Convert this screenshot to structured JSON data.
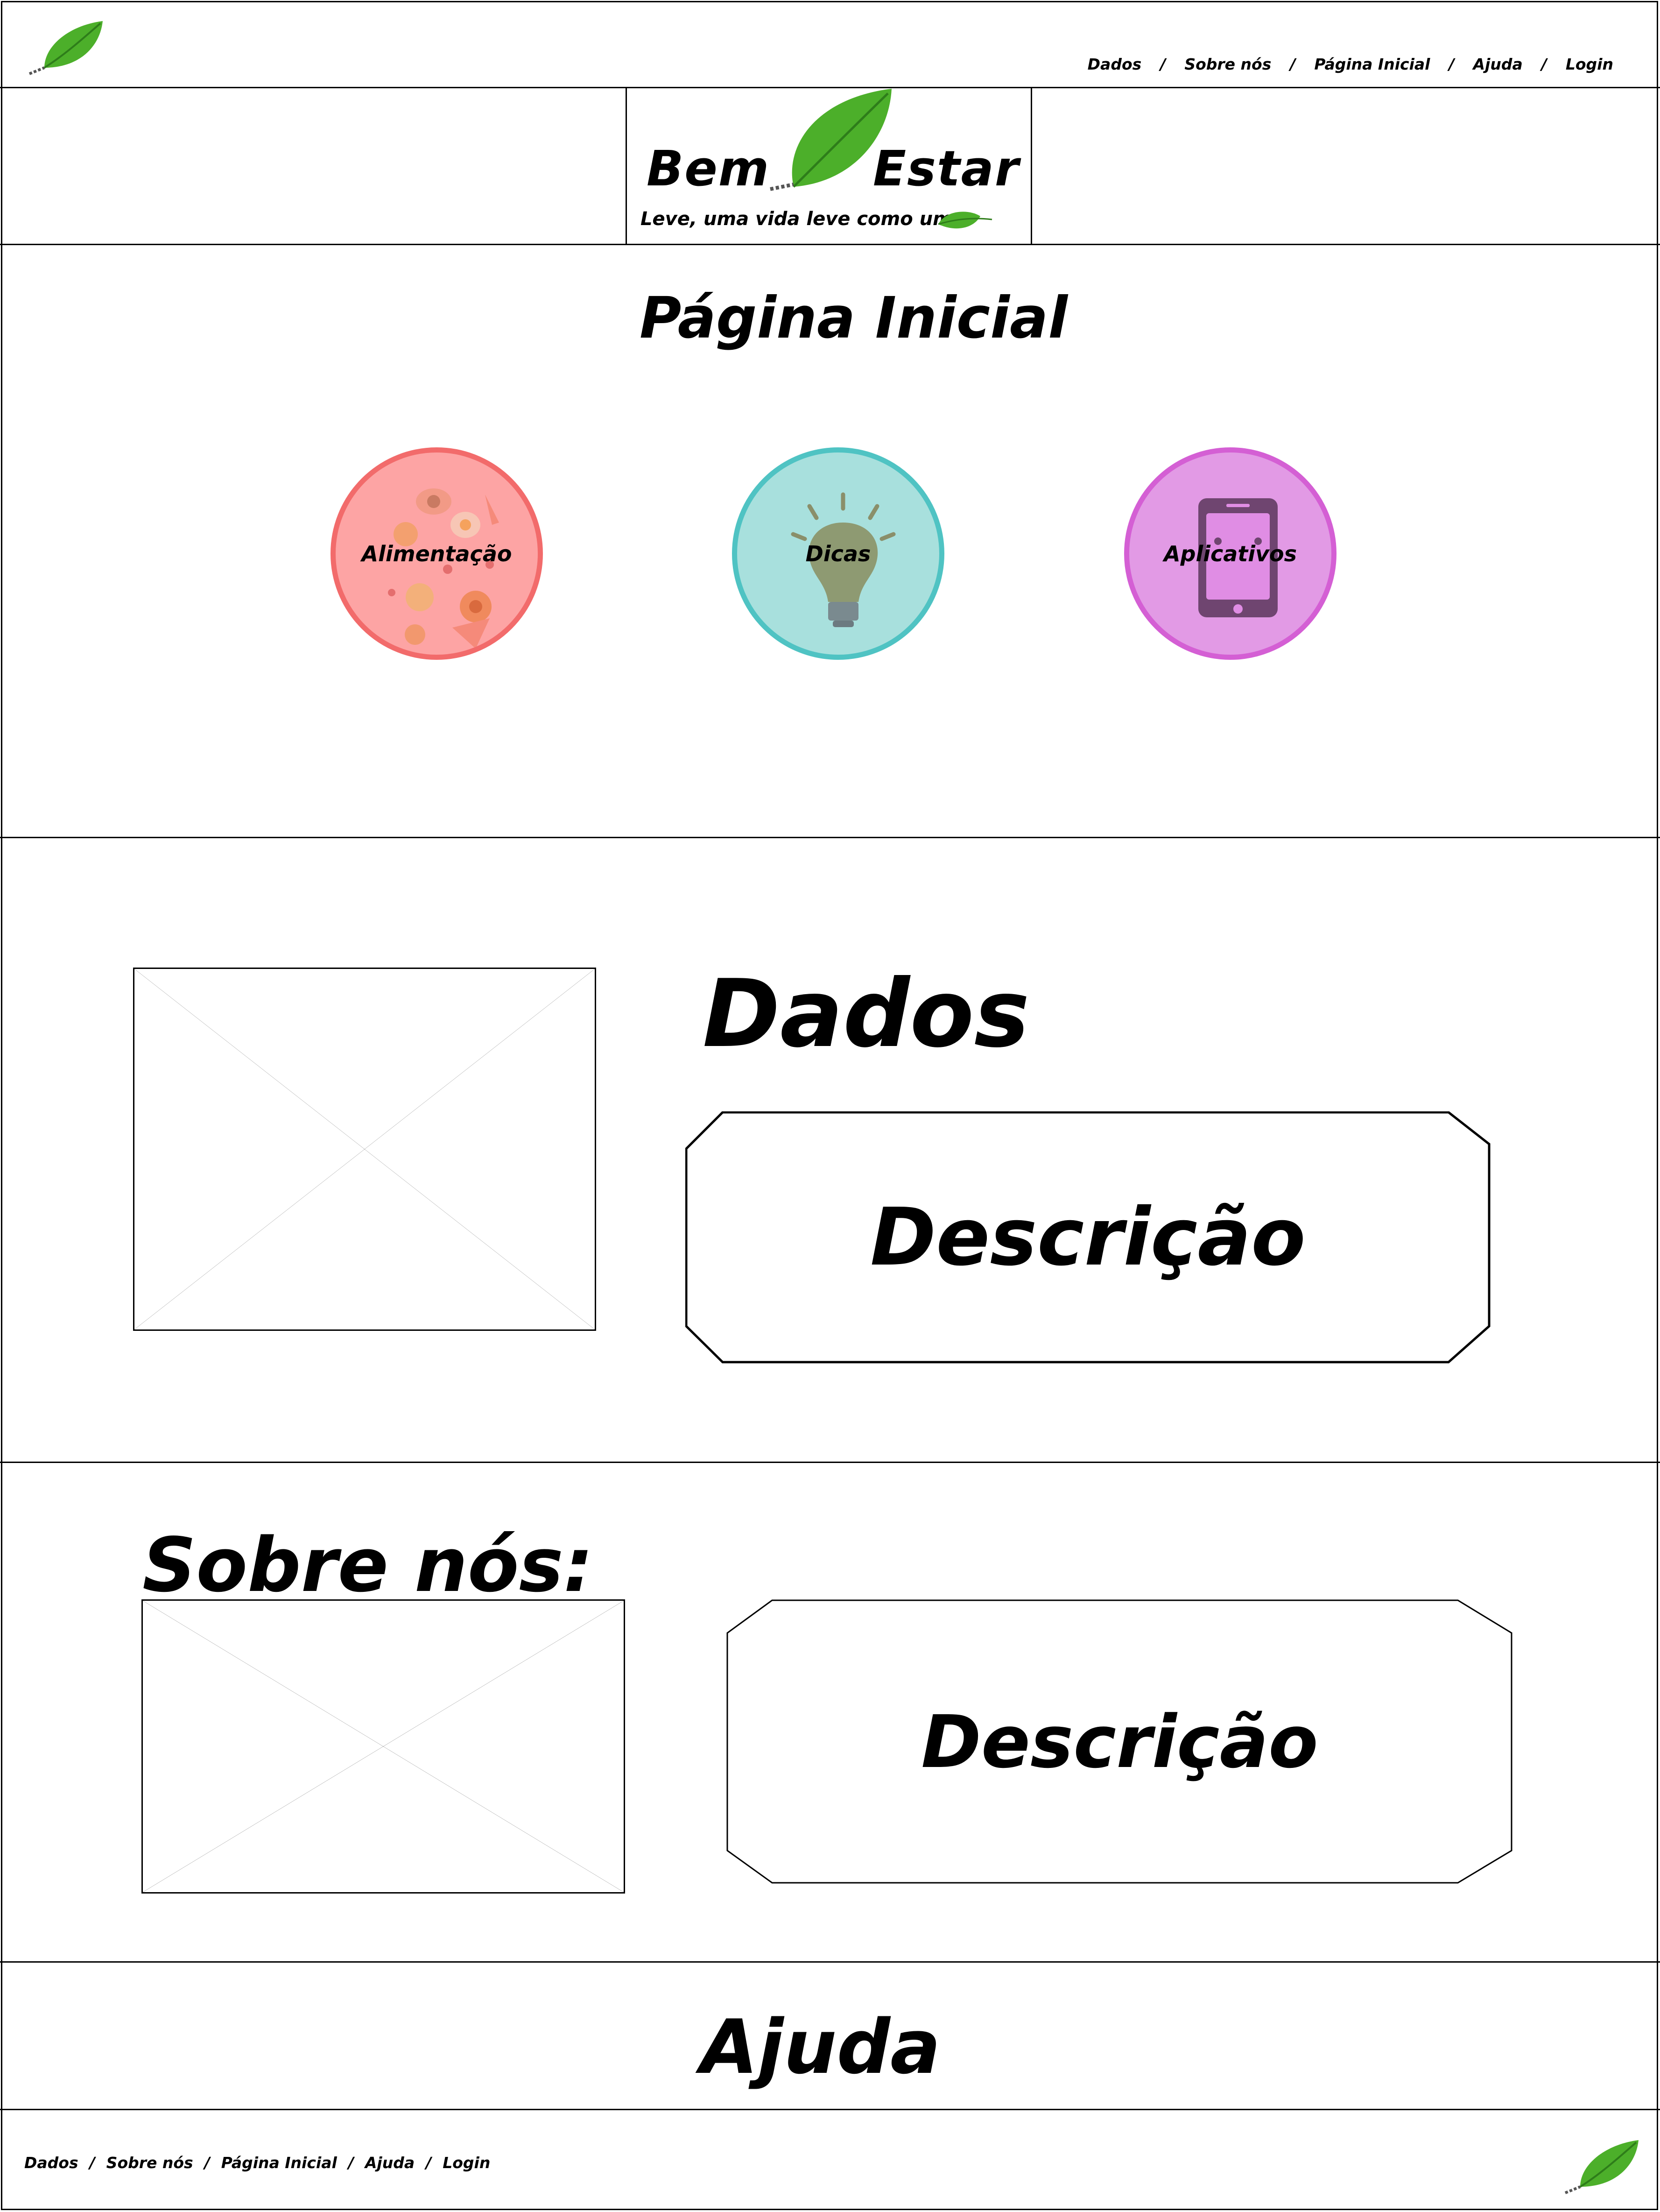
{
  "header": {
    "nav": [
      {
        "label": "Dados"
      },
      {
        "label": "Sobre nós"
      },
      {
        "label": "Página Inicial"
      },
      {
        "label": "Ajuda"
      },
      {
        "label": "Login"
      }
    ],
    "separator": "/"
  },
  "logo": {
    "word1": "Bem",
    "word2": "Estar",
    "tagline": "Leve, uma vida leve como uma"
  },
  "home": {
    "title": "Página Inicial",
    "categories": [
      {
        "label": "Alimentação",
        "color": "#f87171"
      },
      {
        "label": "Dicas",
        "color": "#4fc3c3"
      },
      {
        "label": "Aplicativos",
        "color": "#d45fd4"
      }
    ]
  },
  "dados": {
    "title": "Dados",
    "description": "Descrição"
  },
  "sobre": {
    "title": "Sobre nós:",
    "description": "Descrição"
  },
  "ajuda": {
    "title": "Ajuda"
  },
  "footer": {
    "nav": [
      {
        "label": "Dados"
      },
      {
        "label": "Sobre nós"
      },
      {
        "label": "Página Inicial"
      },
      {
        "label": "Ajuda"
      },
      {
        "label": "Login"
      }
    ],
    "separator": "/"
  },
  "colors": {
    "leaf": "#4caf2a",
    "leaf_dark": "#2e7d1a"
  }
}
